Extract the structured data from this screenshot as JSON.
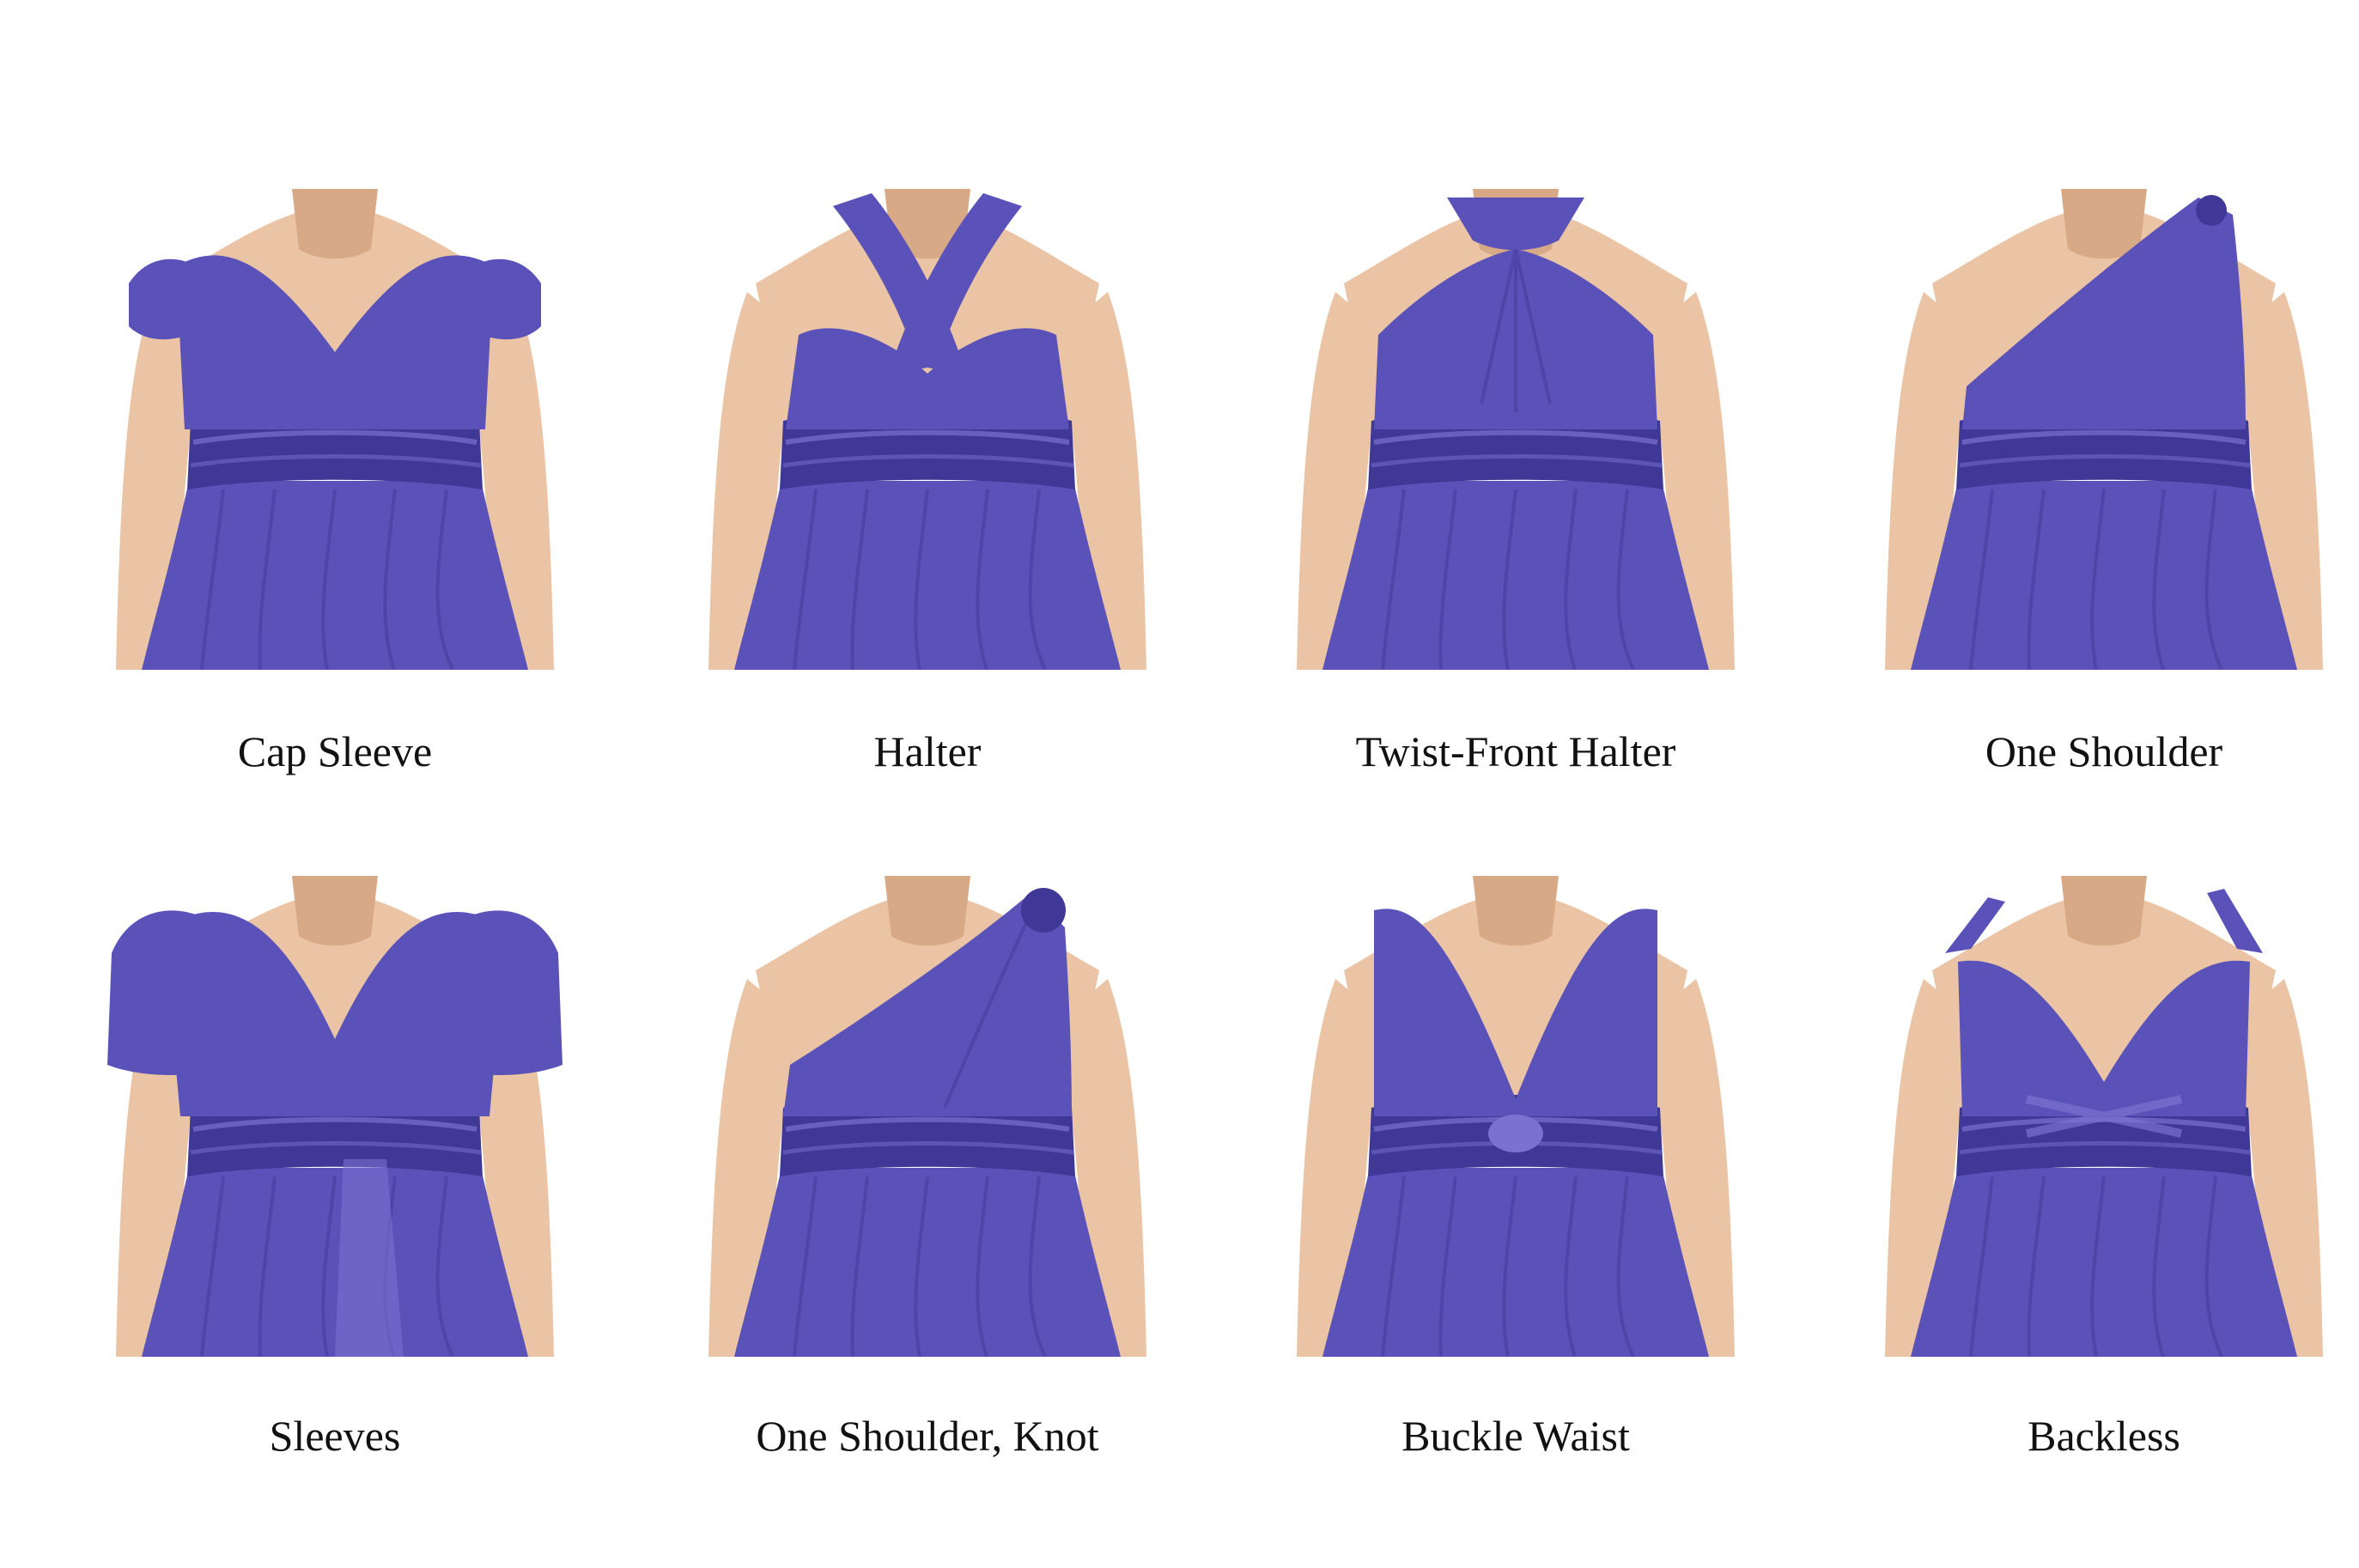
{
  "colors": {
    "background": "#ffffff",
    "dress": "#5a52b8",
    "dress_dark": "#3f3896",
    "dress_light": "#7a72d0",
    "skin": "#eac4a4",
    "skin_shadow": "#d7a986",
    "caption_text": "#111111"
  },
  "styles": [
    {
      "label": "Cap Sleeve",
      "variant": "cap-sleeve"
    },
    {
      "label": "Halter",
      "variant": "halter"
    },
    {
      "label": "Twist-Front Halter",
      "variant": "twist-front-halter"
    },
    {
      "label": "One Shoulder",
      "variant": "one-shoulder"
    },
    {
      "label": "Sleeves",
      "variant": "sleeves"
    },
    {
      "label": "One Shoulder, Knot",
      "variant": "one-shoulder-knot"
    },
    {
      "label": "Buckle Waist",
      "variant": "buckle-waist"
    },
    {
      "label": "Backless",
      "variant": "backless"
    }
  ]
}
